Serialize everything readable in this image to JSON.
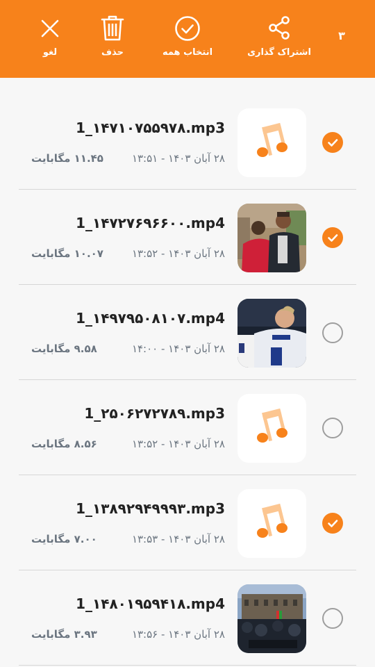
{
  "toolbar": {
    "background": "#f7821b",
    "count": "۳",
    "share_label": "اشتراک گذاری",
    "select_all_label": "انتخاب همه",
    "delete_label": "حذف",
    "cancel_label": "لغو"
  },
  "files": [
    {
      "name": "1_۱۴۷۱۰۷۵۵۹۷۸.mp3",
      "date": "۲۸ آبان ۱۴۰۳ - ۱۳:۵۱",
      "size": "۱۱.۴۵ مگابایت",
      "selected": true,
      "thumb": "music-icon"
    },
    {
      "name": "1_۱۴۷۲۷۶۹۶۶۰۰.mp4",
      "date": "۲۸ آبان ۱۴۰۳ - ۱۳:۵۲",
      "size": "۱۰.۰۷ مگابایت",
      "selected": true,
      "thumb": "video-thumbnail"
    },
    {
      "name": "1_۱۴۹۷۹۵۰۸۱۰۷.mp4",
      "date": "۲۸ آبان ۱۴۰۳ - ۱۴:۰۰",
      "size": "۹.۵۸ مگابایت",
      "selected": false,
      "thumb": "video-thumbnail"
    },
    {
      "name": "1_۲۵۰۶۲۷۲۷۸۹.mp3",
      "date": "۲۸ آبان ۱۴۰۳ - ۱۳:۵۲",
      "size": "۸.۵۶ مگابایت",
      "selected": false,
      "thumb": "music-icon"
    },
    {
      "name": "1_۱۳۸۹۲۹۴۹۹۹۳.mp3",
      "date": "۲۸ آبان ۱۴۰۳ - ۱۳:۵۳",
      "size": "۷.۰۰ مگابایت",
      "selected": true,
      "thumb": "music-icon"
    },
    {
      "name": "1_۱۴۸۰۱۹۵۹۴۱۸.mp4",
      "date": "۲۸ آبان ۱۴۰۳ - ۱۳:۵۶",
      "size": "۳.۹۳ مگابایت",
      "selected": false,
      "thumb": "video-thumbnail"
    }
  ]
}
